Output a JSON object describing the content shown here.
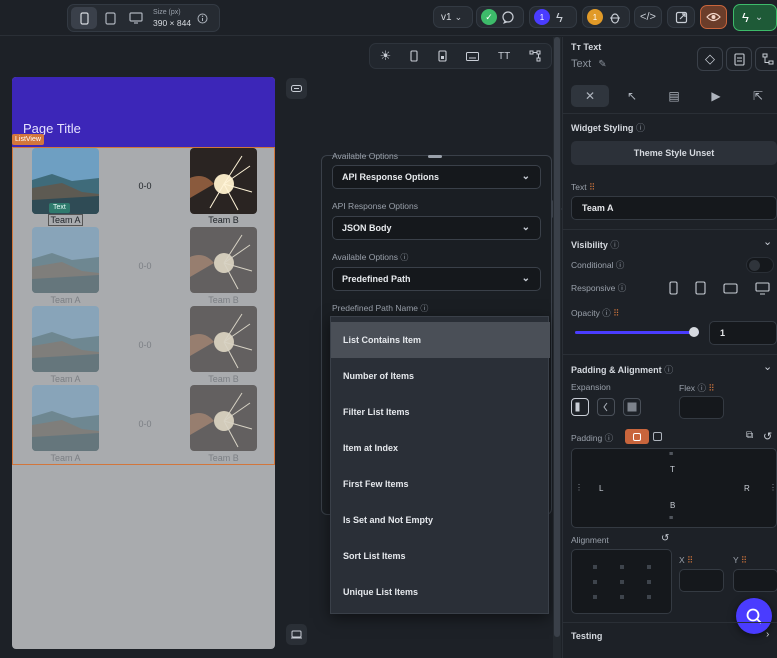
{
  "topbar": {
    "size_label": "Size (px)",
    "size_value": "390 × 844",
    "version": "v1",
    "badge1": "1",
    "badge2": "1"
  },
  "colors": {
    "accent": "#3c26b8",
    "listview": "#d2763c",
    "green": "#3dbb6a",
    "purple": "#4a3cff",
    "orange": "#e19a28"
  },
  "phone": {
    "page_title": "Page Title",
    "listview_tag": "ListView",
    "text_tag": "Text",
    "rows": [
      {
        "left": "Team A",
        "mid": "0-0",
        "right": "Team B"
      },
      {
        "left": "Team A",
        "mid": "0-0",
        "right": "Team B"
      },
      {
        "left": "Team A",
        "mid": "0-0",
        "right": "Team B"
      },
      {
        "left": "Team A",
        "mid": "0-0",
        "right": "Team B"
      }
    ]
  },
  "config": {
    "available_options_cut": "Available Options",
    "dd1": "API Response Options",
    "label2": "API Response Options",
    "dd2": "JSON Body",
    "label3": "Available Options",
    "dd3": "Predefined Path",
    "label4": "Predefined Path Name",
    "menu": [
      "List Contains Item",
      "Number of Items",
      "Filter List Items",
      "Item at Index",
      "First Few Items",
      "Is Set and Not Empty",
      "Sort List Items",
      "Unique List Items"
    ]
  },
  "panel": {
    "widget_type": "Text",
    "widget_name": "Text",
    "widget_styling": "Widget Styling",
    "theme_style": "Theme Style Unset",
    "text_label": "Text",
    "text_value": "Team A",
    "visibility": "Visibility",
    "conditional": "Conditional",
    "responsive": "Responsive",
    "opacity": "Opacity",
    "opacity_value": "1",
    "opacity_level": 1.0,
    "padding_alignment": "Padding & Alignment",
    "expansion": "Expansion",
    "flex": "Flex",
    "padding": "Padding",
    "pad_t": "T",
    "pad_l": "L",
    "pad_r": "R",
    "pad_b": "B",
    "alignment": "Alignment",
    "x_label": "X",
    "y_label": "Y",
    "testing": "Testing"
  }
}
